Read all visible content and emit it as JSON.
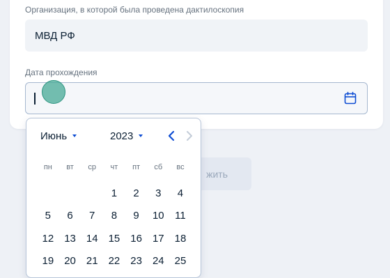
{
  "form": {
    "org_label": "Организация, в которой была проведена дактилоскопия",
    "org_value": "МВД РФ",
    "date_label": "Дата прохождения",
    "date_value": ""
  },
  "background_button": {
    "label_fragment": "жить"
  },
  "datepicker": {
    "month": "Июнь",
    "year": "2023",
    "weekdays": [
      "пн",
      "вт",
      "ср",
      "чт",
      "пт",
      "сб",
      "вс"
    ],
    "weeks": [
      [
        "",
        "",
        "",
        "1",
        "2",
        "3",
        "4"
      ],
      [
        "5",
        "6",
        "7",
        "8",
        "9",
        "10",
        "11"
      ],
      [
        "12",
        "13",
        "14",
        "15",
        "16",
        "17",
        "18"
      ],
      [
        "19",
        "20",
        "21",
        "22",
        "23",
        "24",
        "25"
      ]
    ],
    "icons": {
      "prev": "chevron-left-icon",
      "next": "chevron-right-icon",
      "dropdown": "triangle-down-icon"
    }
  },
  "colors": {
    "accent": "#0d4cd3",
    "text": "#0b1f33",
    "muted": "#66727f",
    "input_border": "#a5b7cf",
    "cursor_marker": "#46aa96"
  },
  "icons": {
    "date_field": "calendar-icon"
  }
}
